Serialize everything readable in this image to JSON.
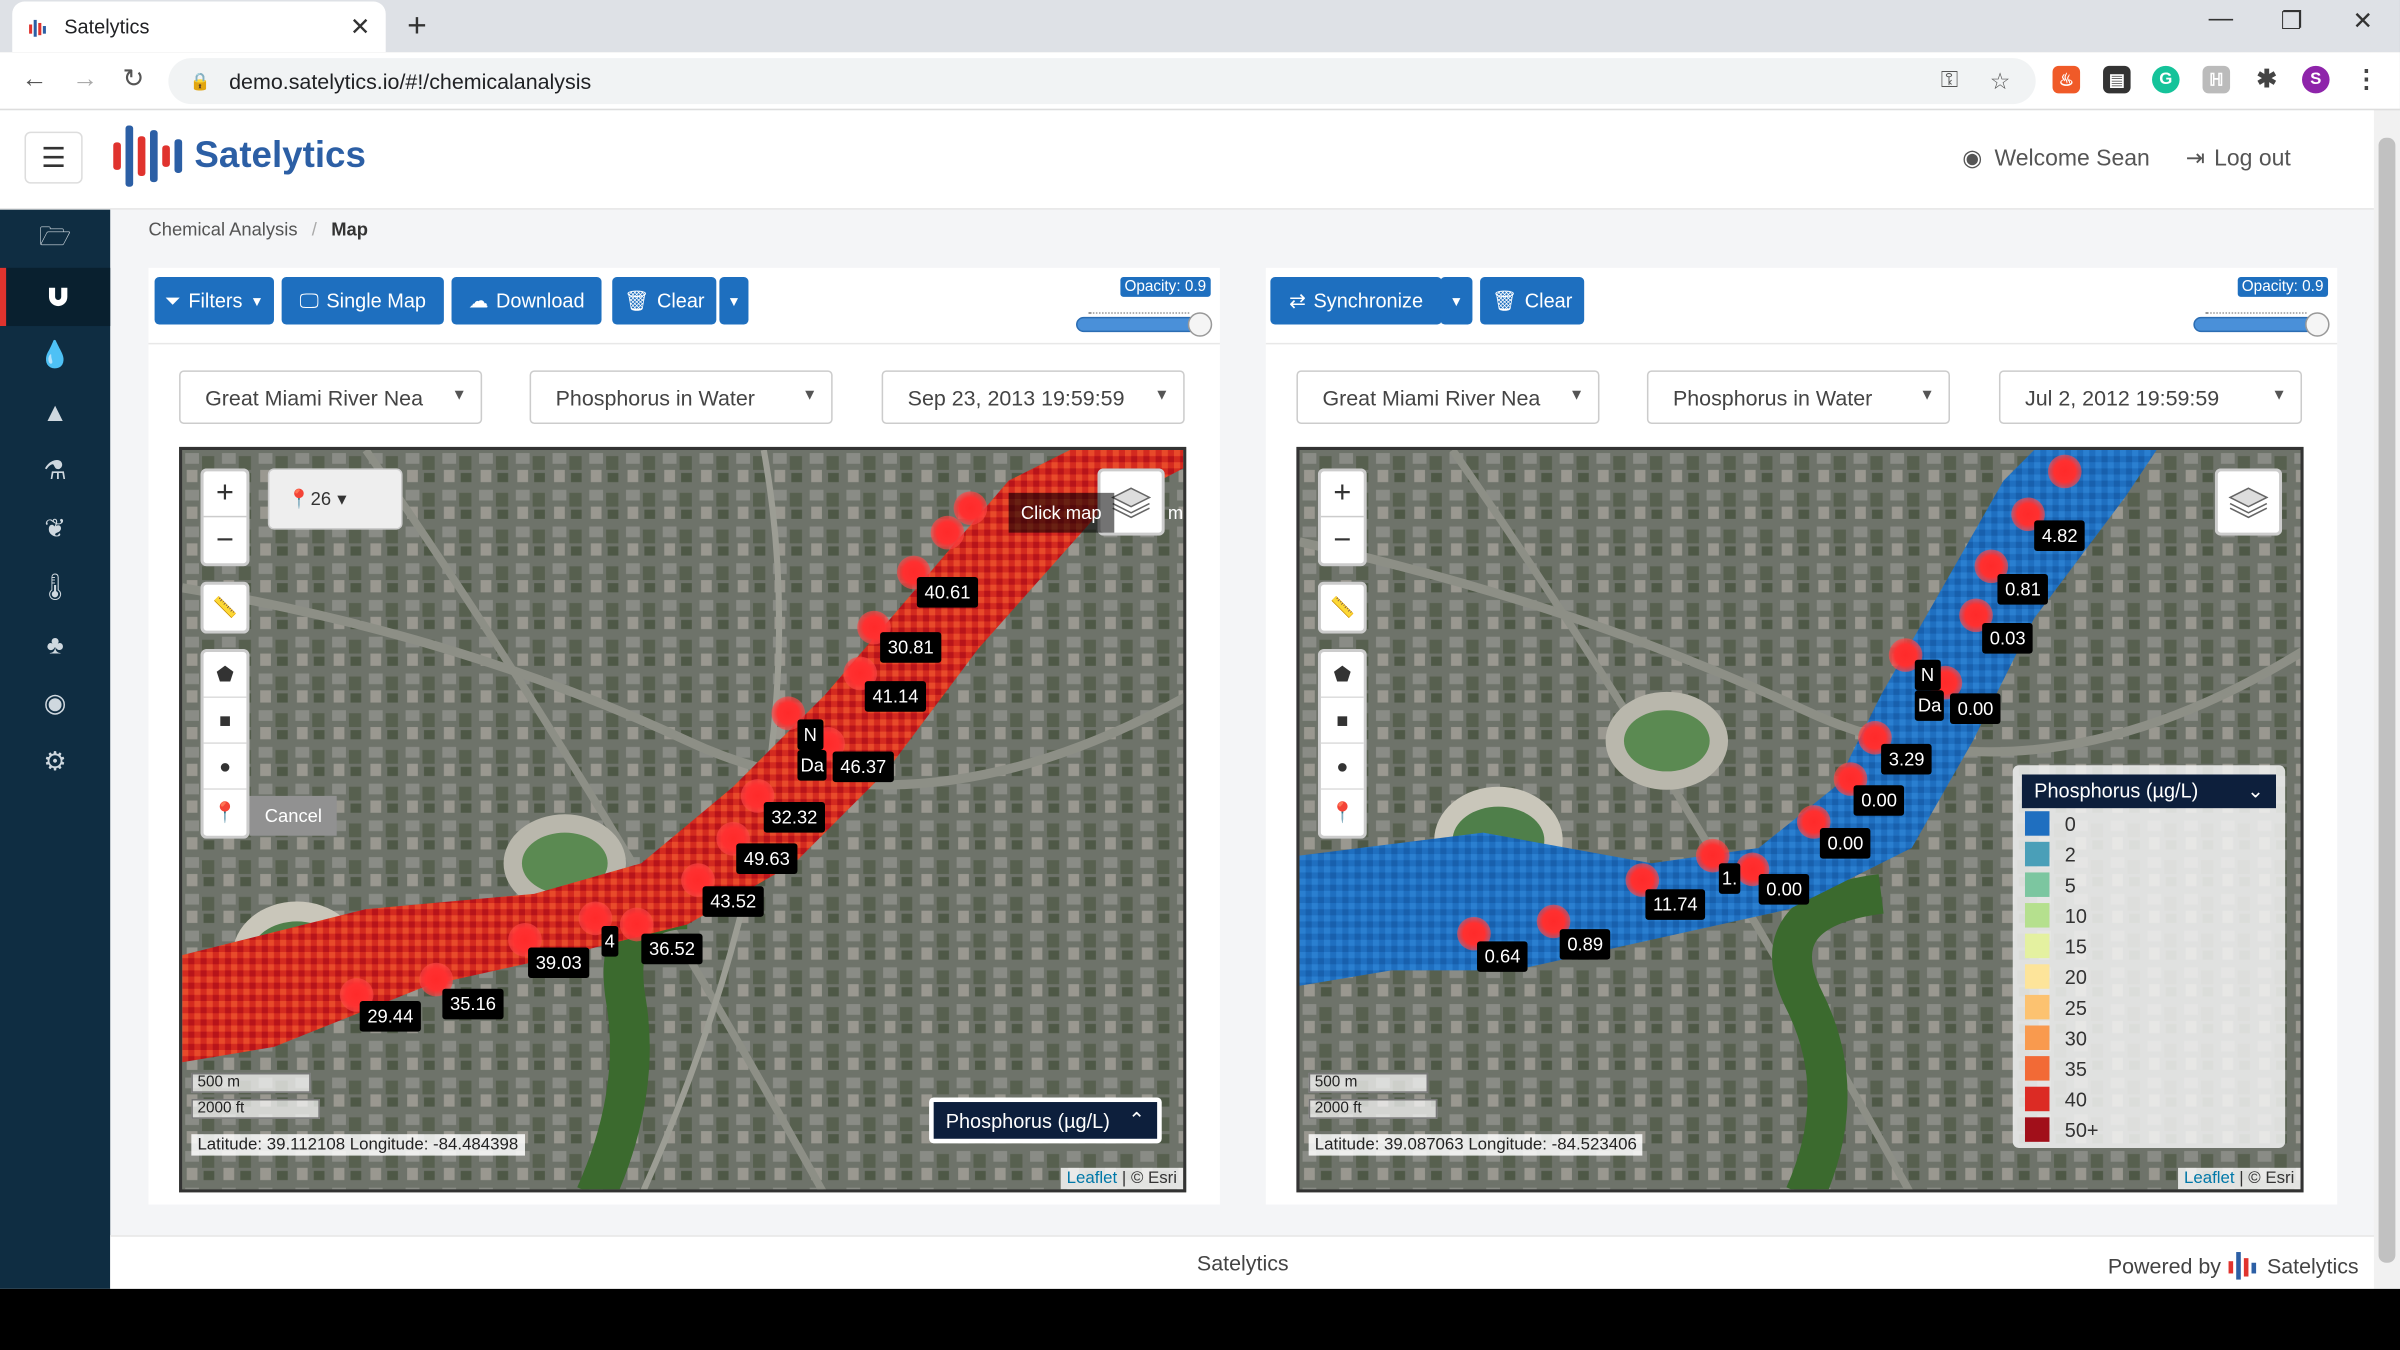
{
  "browser": {
    "tab_title": "Satelytics",
    "url": "demo.satelytics.io/#!/chemicalanalysis",
    "profile_initial": "S"
  },
  "header": {
    "brand": "Satelytics",
    "welcome": "Welcome Sean",
    "logout": "Log out"
  },
  "sidebar": {
    "icons": [
      "folder-open-icon",
      "magnet-icon",
      "droplet-icon",
      "warning-icon",
      "flask-icon",
      "leaf-icon",
      "thermometer-icon",
      "tree-icon",
      "user-circle-icon",
      "cogs-icon"
    ],
    "active_index": 1
  },
  "breadcrumb": {
    "parent": "Chemical Analysis",
    "separator": "/",
    "current": "Map"
  },
  "left_panel": {
    "buttons": {
      "filters": "Filters",
      "single_map": "Single Map",
      "download": "Download",
      "clear": "Clear"
    },
    "opacity": "Opacity: 0.9",
    "opacity_value": 0.9,
    "location": "Great Miami River Nea",
    "chemical": "Phosphorus in Water",
    "date": "Sep 23, 2013 19:59:59",
    "cluster_count": "26",
    "tooltip": "Click map",
    "tooltip_cut": "m",
    "cancel": "Cancel",
    "scale_m": "500 m",
    "scale_ft": "2000 ft",
    "coords": "Latitude: 39.112108 Longitude: -84.484398",
    "legend_toggle": "Phosphorus (µg/L)",
    "labels": [
      "40.61",
      "30.81",
      "41.14",
      "46.37",
      "32.32",
      "49.63",
      "43.52",
      "36.52",
      "39.03",
      "35.16",
      "29.44"
    ],
    "partial_labels": [
      "N",
      "Da",
      "4"
    ]
  },
  "right_panel": {
    "buttons": {
      "synchronize": "Synchronize",
      "clear": "Clear"
    },
    "opacity": "Opacity: 0.9",
    "opacity_value": 0.9,
    "location": "Great Miami River Nea",
    "chemical": "Phosphorus in Water",
    "date": "Jul 2, 2012 19:59:59",
    "scale_m": "500 m",
    "scale_ft": "2000 ft",
    "coords": "Latitude: 39.087063 Longitude: -84.523406",
    "labels": [
      "4.82",
      "0.81",
      "0.03",
      "0.00",
      "3.29",
      "0.00",
      "0.00",
      "0.00",
      "11.74",
      "0.89",
      "0.64"
    ],
    "partial_labels": [
      "N",
      "Da",
      "1."
    ],
    "legend": {
      "title": "Phosphorus (µg/L)",
      "items": [
        {
          "label": "0",
          "color": "#1f6fc0"
        },
        {
          "label": "2",
          "color": "#4a9fb8"
        },
        {
          "label": "5",
          "color": "#7cc6a0"
        },
        {
          "label": "10",
          "color": "#b5e08e"
        },
        {
          "label": "15",
          "color": "#e4f1a0"
        },
        {
          "label": "20",
          "color": "#fde49a"
        },
        {
          "label": "25",
          "color": "#fcc270"
        },
        {
          "label": "30",
          "color": "#f99a4e"
        },
        {
          "label": "35",
          "color": "#f26a36"
        },
        {
          "label": "40",
          "color": "#dc2b24"
        },
        {
          "label": "50+",
          "color": "#a10f1a"
        }
      ]
    }
  },
  "attribution": {
    "leaflet": "Leaflet",
    "esri": " | © Esri"
  },
  "footer": {
    "center": "Satelytics",
    "powered_by": "Powered by",
    "brand": "Satelytics"
  }
}
